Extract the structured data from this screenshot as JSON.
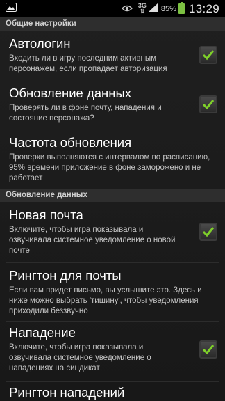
{
  "status_bar": {
    "network": "3G",
    "battery": "85%",
    "time": "13:29"
  },
  "sections": [
    {
      "header": "Общие настройки"
    },
    {
      "header": "Обновление данных"
    }
  ],
  "settings": [
    {
      "title": "Автологин",
      "summary": "Входить ли в игру последним активным персонажем, если пропадает авторизация",
      "checked": true
    },
    {
      "title": "Обновление данных",
      "summary": "Проверять ли в фоне почту, нападения и состояние персонажа?",
      "checked": true
    },
    {
      "title": "Частота обновления",
      "summary": "Проверки выполняются с интервалом по расписанию, 95% времени приложение в фоне заморожено и не работает"
    },
    {
      "title": "Новая почта",
      "summary": "Включите, чтобы игра показывала и озвучивала системное уведомление о новой почте",
      "checked": true
    },
    {
      "title": "Рингтон для почты",
      "summary": "Если вам придет письмо, вы услышите это. Здесь и ниже можно выбрать 'тишину', чтобы уведомления приходили беззвучно"
    },
    {
      "title": "Нападение",
      "summary": "Включите, чтобы игра показывала и озвучивала системное уведомление о нападениях на синдикат",
      "checked": true
    },
    {
      "title": "Рингтон нападений"
    }
  ],
  "colors": {
    "checkmark": "#7fd02a",
    "battery": "#7cc142"
  }
}
